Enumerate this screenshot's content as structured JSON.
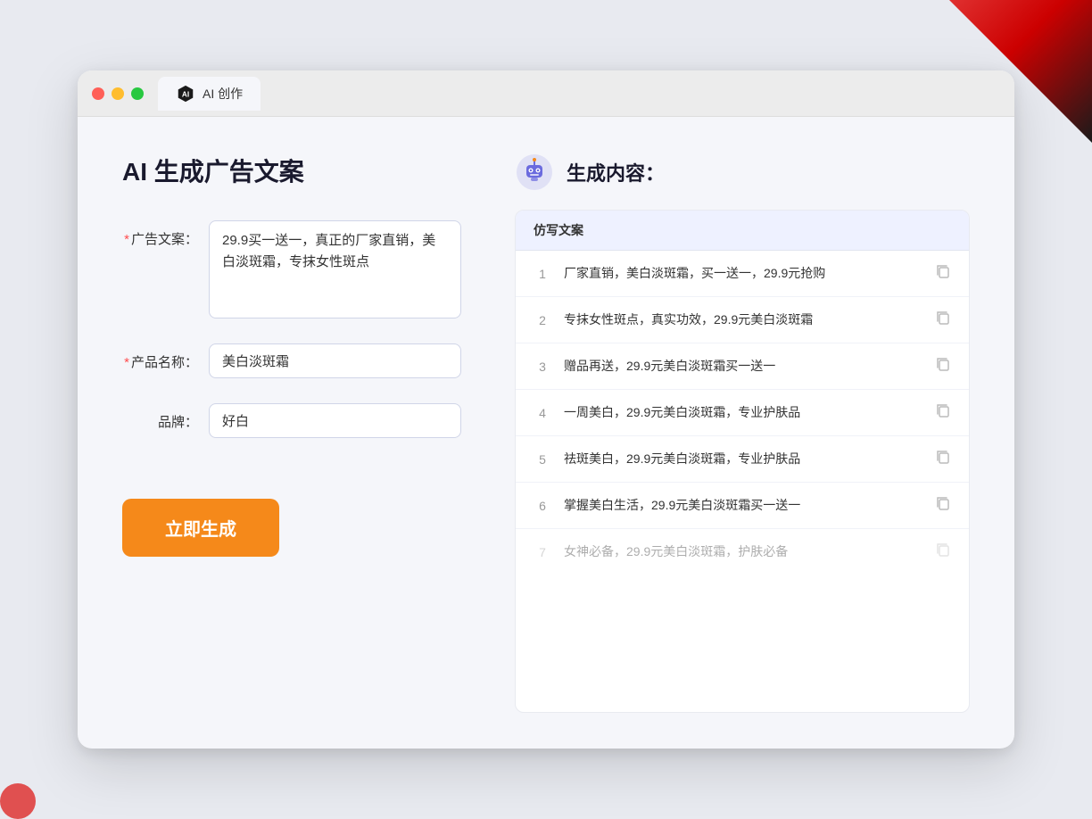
{
  "window": {
    "tab_label": "AI 创作"
  },
  "page": {
    "title": "AI 生成广告文案"
  },
  "form": {
    "ad_copy_label": "广告文案：",
    "ad_copy_required": true,
    "ad_copy_value": "29.9买一送一，真正的厂家直销，美白淡斑霜，专抹女性斑点",
    "product_name_label": "产品名称：",
    "product_name_required": true,
    "product_name_value": "美白淡斑霜",
    "brand_label": "品牌：",
    "brand_required": false,
    "brand_value": "好白",
    "generate_button_label": "立即生成"
  },
  "result": {
    "header_title": "生成内容：",
    "table_header": "仿写文案",
    "items": [
      {
        "number": "1",
        "text": "厂家直销，美白淡斑霜，买一送一，29.9元抢购",
        "faded": false
      },
      {
        "number": "2",
        "text": "专抹女性斑点，真实功效，29.9元美白淡斑霜",
        "faded": false
      },
      {
        "number": "3",
        "text": "赠品再送，29.9元美白淡斑霜买一送一",
        "faded": false
      },
      {
        "number": "4",
        "text": "一周美白，29.9元美白淡斑霜，专业护肤品",
        "faded": false
      },
      {
        "number": "5",
        "text": "祛斑美白，29.9元美白淡斑霜，专业护肤品",
        "faded": false
      },
      {
        "number": "6",
        "text": "掌握美白生活，29.9元美白淡斑霜买一送一",
        "faded": false
      },
      {
        "number": "7",
        "text": "女神必备，29.9元美白淡斑霜，护肤必备",
        "faded": true
      }
    ]
  },
  "colors": {
    "accent": "#f5891a",
    "primary": "#5b7fff",
    "required": "#ff4d4f"
  }
}
